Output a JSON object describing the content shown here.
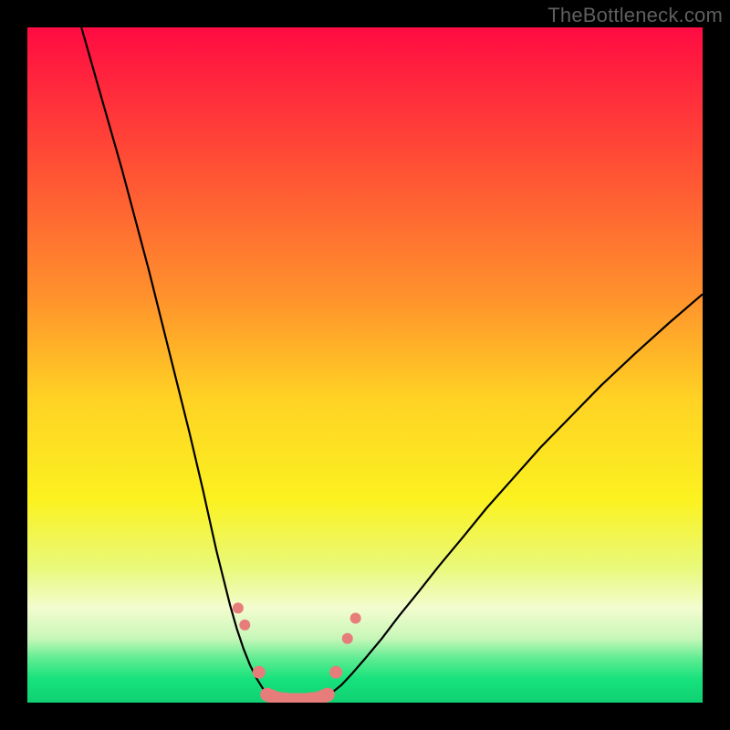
{
  "watermark": "TheBottleneck.com",
  "chart_data": {
    "type": "line",
    "title": "",
    "xlabel": "",
    "ylabel": "",
    "xlim": [
      0,
      100
    ],
    "ylim": [
      0,
      100
    ],
    "background_gradient": [
      {
        "stop": 0.0,
        "color": "#ff0b42"
      },
      {
        "stop": 0.2,
        "color": "#ff4e35"
      },
      {
        "stop": 0.4,
        "color": "#ff922c"
      },
      {
        "stop": 0.55,
        "color": "#ffd224"
      },
      {
        "stop": 0.7,
        "color": "#fbf220"
      },
      {
        "stop": 0.8,
        "color": "#e9f97a"
      },
      {
        "stop": 0.86,
        "color": "#f3fccf"
      },
      {
        "stop": 0.905,
        "color": "#c7f7b8"
      },
      {
        "stop": 0.935,
        "color": "#5eec92"
      },
      {
        "stop": 0.965,
        "color": "#17e27c"
      },
      {
        "stop": 1.0,
        "color": "#0fd173"
      }
    ],
    "series": [
      {
        "name": "left-curve",
        "color": "#000000",
        "width": 2.2,
        "x": [
          8.0,
          10.0,
          12.0,
          14.0,
          16.0,
          18.0,
          20.0,
          22.0,
          24.0,
          26.0,
          27.0,
          28.0,
          29.0,
          30.0,
          31.0,
          32.0,
          33.0,
          34.0,
          34.8,
          35.6,
          36.3
        ],
        "y": [
          100.0,
          93.0,
          86.0,
          79.0,
          71.5,
          64.0,
          56.0,
          48.0,
          40.0,
          31.5,
          27.0,
          22.5,
          18.5,
          14.5,
          11.0,
          8.0,
          5.5,
          3.5,
          2.2,
          1.2,
          0.6
        ]
      },
      {
        "name": "right-curve",
        "color": "#000000",
        "width": 2.2,
        "x": [
          43.7,
          45.0,
          46.5,
          48.0,
          50.0,
          52.5,
          55.0,
          58.0,
          61.0,
          64.5,
          68.0,
          72.0,
          76.0,
          80.5,
          85.0,
          90.0,
          95.0,
          100.0
        ],
        "y": [
          0.6,
          1.4,
          2.6,
          4.2,
          6.5,
          9.5,
          12.8,
          16.5,
          20.3,
          24.5,
          28.8,
          33.3,
          37.8,
          42.4,
          47.0,
          51.7,
          56.2,
          60.5
        ]
      },
      {
        "name": "valley-floor",
        "color": "#e77d7a",
        "width": 15,
        "linecap": "round",
        "x": [
          35.5,
          37.0,
          39.0,
          41.0,
          43.0,
          44.5
        ],
        "y": [
          1.2,
          0.6,
          0.4,
          0.4,
          0.6,
          1.2
        ]
      }
    ],
    "markers": [
      {
        "name": "dot-left-upper",
        "x": 31.2,
        "y": 14.0,
        "r": 6,
        "color": "#e77d7a"
      },
      {
        "name": "dot-left-lower",
        "x": 32.2,
        "y": 11.5,
        "r": 6,
        "color": "#e77d7a"
      },
      {
        "name": "dot-left-trans",
        "x": 34.3,
        "y": 4.5,
        "r": 7,
        "color": "#e77d7a"
      },
      {
        "name": "dot-right-trans",
        "x": 45.7,
        "y": 4.5,
        "r": 7,
        "color": "#e77d7a"
      },
      {
        "name": "dot-right-lower",
        "x": 47.4,
        "y": 9.5,
        "r": 6,
        "color": "#e77d7a"
      },
      {
        "name": "dot-right-upper",
        "x": 48.6,
        "y": 12.5,
        "r": 6,
        "color": "#e77d7a"
      }
    ]
  }
}
